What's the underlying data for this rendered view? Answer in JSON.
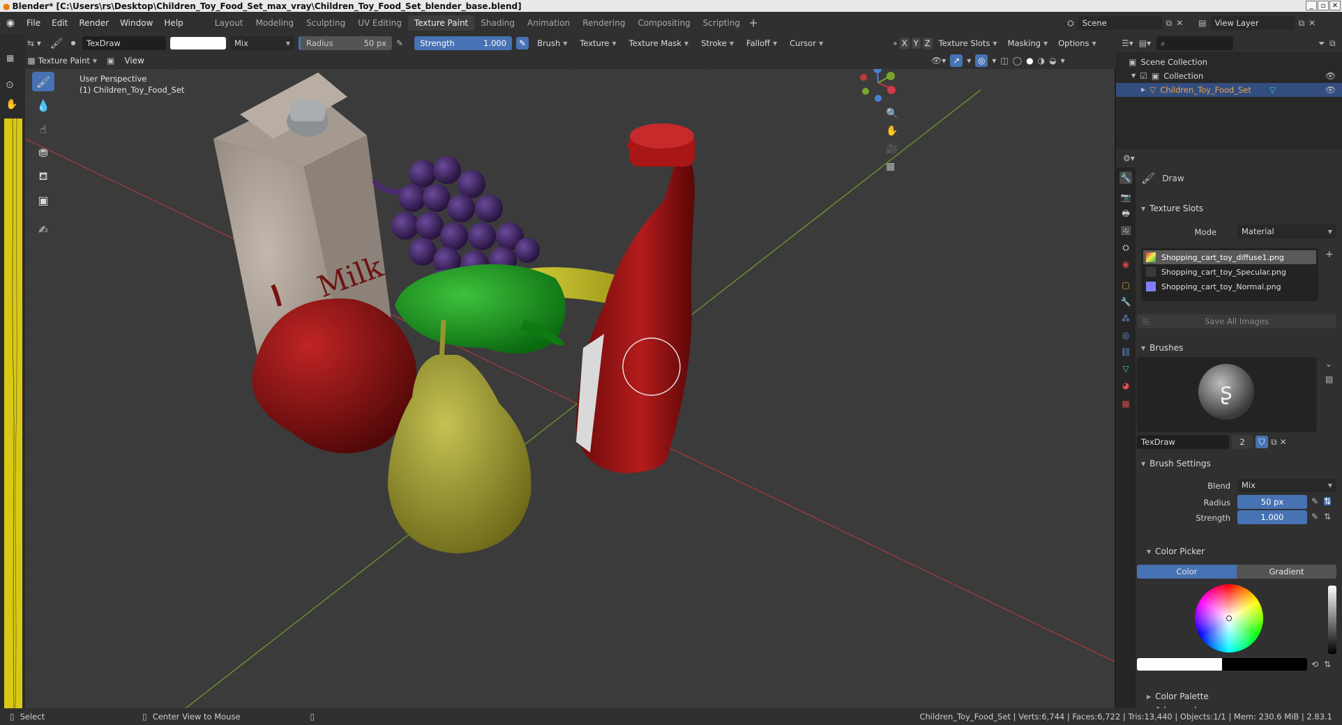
{
  "title_bar": {
    "text": "Blender* [C:\\Users\\rs\\Desktop\\Children_Toy_Food_Set_max_vray\\Children_Toy_Food_Set_blender_base.blend]"
  },
  "menu": [
    "File",
    "Edit",
    "Render",
    "Window",
    "Help"
  ],
  "workspaces": [
    "Layout",
    "Modeling",
    "Sculpting",
    "UV Editing",
    "Texture Paint",
    "Shading",
    "Animation",
    "Rendering",
    "Compositing",
    "Scripting"
  ],
  "scene": {
    "name": "Scene",
    "view_layer": "View Layer"
  },
  "tool_header": {
    "brush_name": "TexDraw",
    "blend": "Mix",
    "radius_label": "Radius",
    "radius_value": "50 px",
    "strength_label": "Strength",
    "strength_value": "1.000",
    "menus": [
      "Brush",
      "Texture",
      "Texture Mask",
      "Stroke",
      "Falloff",
      "Cursor"
    ],
    "axes": [
      "X",
      "Y",
      "Z"
    ],
    "right_menus": [
      "Texture Slots",
      "Masking",
      "Options"
    ]
  },
  "viewport_header": {
    "mode": "Texture Paint",
    "view": "View"
  },
  "viewport": {
    "perspective": "User Perspective",
    "object": "(1) Children_Toy_Food_Set",
    "milk_text": "Milk"
  },
  "outliner": {
    "scene_collection": "Scene Collection",
    "collection": "Collection",
    "object": "Children_Toy_Food_Set"
  },
  "properties": {
    "tool": "Draw",
    "texture_slots": {
      "title": "Texture Slots",
      "mode_label": "Mode",
      "mode_value": "Material",
      "slots": [
        "Shopping_cart_toy_diffuse1.png",
        "Shopping_cart_toy_Specular.png",
        "Shopping_cart_toy_Normal.png"
      ],
      "save_all": "Save All Images"
    },
    "brushes": {
      "title": "Brushes",
      "brush_name": "TexDraw",
      "users": "2"
    },
    "brush_settings": {
      "title": "Brush Settings",
      "blend_label": "Blend",
      "blend_value": "Mix",
      "radius_label": "Radius",
      "radius_value": "50 px",
      "strength_label": "Strength",
      "strength_value": "1.000"
    },
    "color_picker": {
      "title": "Color Picker",
      "tab_color": "Color",
      "tab_gradient": "Gradient"
    },
    "color_palette": "Color Palette",
    "advanced": "Advanced"
  },
  "status": {
    "select": "Select",
    "center": "Center View to Mouse",
    "stats": "Children_Toy_Food_Set | Verts:6,744 | Faces:6,722 | Tris:13,440 | Objects:1/1 | Mem: 230.6 MiB | 2.83.1"
  }
}
